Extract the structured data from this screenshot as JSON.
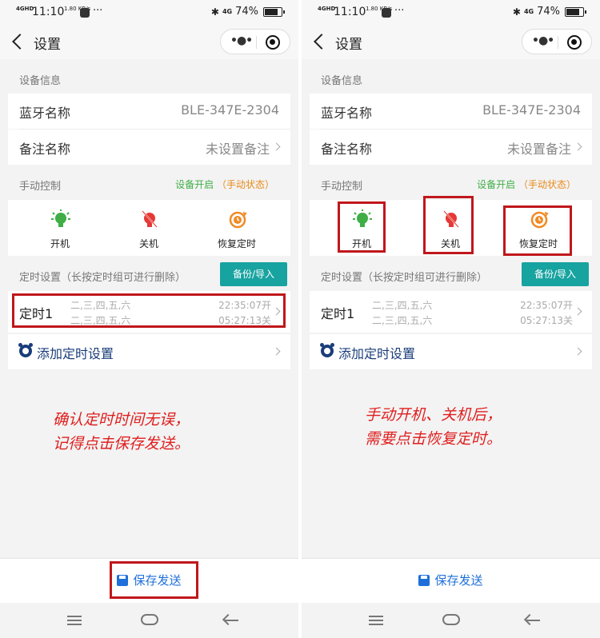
{
  "status_bar": {
    "network": "4GHD",
    "time": "11:10",
    "speed": "1.80 KB/s",
    "more": "···",
    "signal": "4G",
    "battery": "74%"
  },
  "nav": {
    "title": "设置",
    "menu_icon": "•●•"
  },
  "device_info": {
    "section_title": "设备信息",
    "bt_label": "蓝牙名称",
    "bt_value": "BLE-347E-2304",
    "note_label": "备注名称",
    "note_value": "未设置备注"
  },
  "manual": {
    "section_title": "手动控制",
    "status_on": "设备开启",
    "status_mode": "（手动状态）",
    "power_on": "开机",
    "power_off": "关机",
    "restore": "恢复定时"
  },
  "timer": {
    "section_title": "定时设置（长按定时组可进行删除）",
    "backup_button": "备份/导入",
    "name": "定时1",
    "days_on": "二,三,四,五,六",
    "days_off": "二,三,四,五,六",
    "time_on": "22:35:07开",
    "time_off": "05:27:13关",
    "add_label": "添加定时设置"
  },
  "footer": {
    "save_label": "保存发送"
  },
  "annotations": {
    "left_line1": "确认定时时间无误，",
    "left_line2": "记得点击保存发送。",
    "right_line1": "手动开机、关机后，",
    "right_line2": "需要点击恢复定时。"
  },
  "colors": {
    "accent_teal": "#17a3a0",
    "on_green": "#3fae46",
    "off_red": "#e53935",
    "restore_orange": "#f08a24",
    "save_blue": "#1e6fd9",
    "annotation_red": "#e01e1e"
  }
}
